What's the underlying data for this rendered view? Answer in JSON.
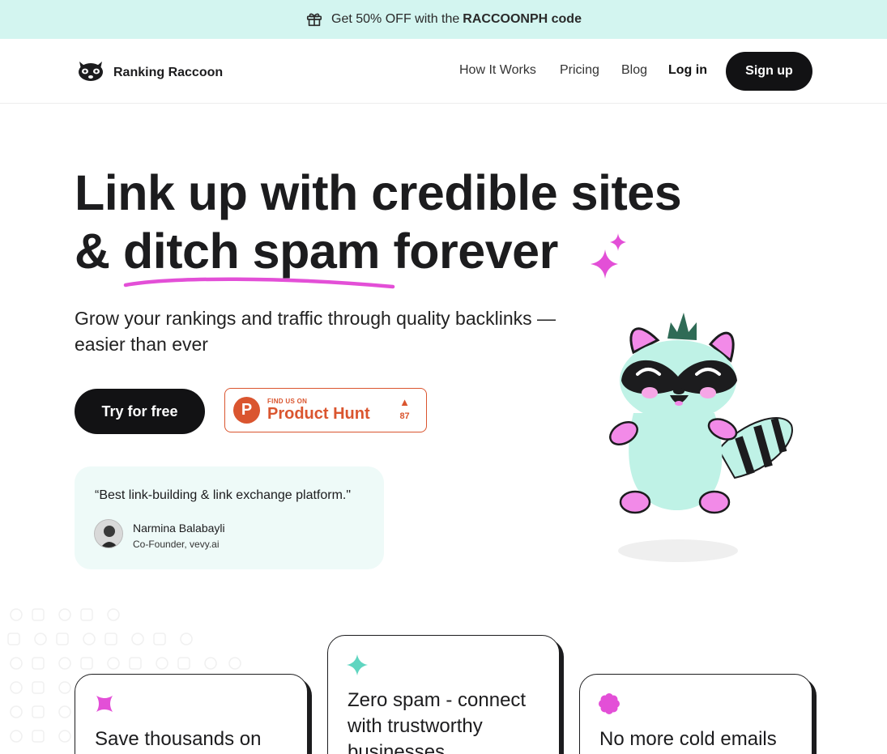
{
  "promo": {
    "text_before": "Get 50% OFF with the",
    "code": "RACCOONPH code",
    "icon": "gift-icon"
  },
  "nav": {
    "brand": "Ranking Raccoon",
    "links": [
      "How It Works",
      "Pricing",
      "Blog"
    ],
    "login": "Log in",
    "signup": "Sign up"
  },
  "hero": {
    "title_line1": "Link up with credible sites",
    "title_line2_prefix": "&",
    "title_line2_highlight": "ditch spam",
    "title_line2_suffix": "forever",
    "subtitle": "Grow your rankings and traffic through quality backlinks — easier than ever",
    "cta": "Try for free"
  },
  "product_hunt": {
    "small": "FIND US ON",
    "big": "Product Hunt",
    "votes": "87",
    "logo_letter": "P"
  },
  "testimonial": {
    "quote": "“Best link-building & link exchange platform.\"",
    "name": "Narmina Balabayli",
    "role": "Co-Founder, vevy.ai"
  },
  "features": [
    {
      "title": "Save thousands on",
      "icon": "pink-x-sparkle-icon"
    },
    {
      "title": "Zero spam - connect with trustworthy businesses",
      "icon": "teal-sparkle-icon"
    },
    {
      "title": "No more cold emails",
      "icon": "pink-flower-icon"
    }
  ],
  "colors": {
    "promo_bg": "#d3f5f0",
    "accent_pink": "#e34fd7",
    "accent_teal": "#5fd5c0",
    "dark": "#121214",
    "ph_orange": "#da552f",
    "testimonial_bg": "#eefaf8"
  }
}
